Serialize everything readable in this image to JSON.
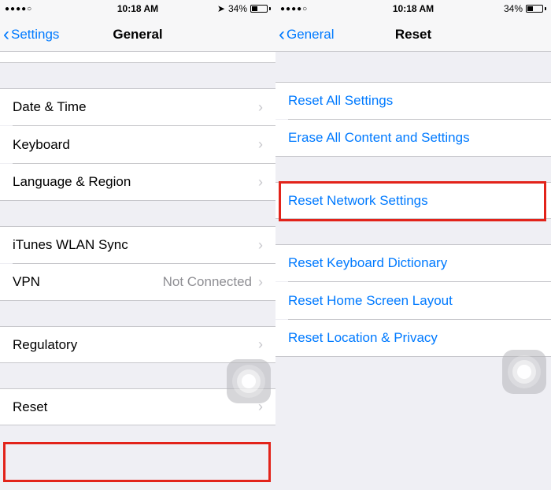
{
  "left": {
    "status": {
      "signal": "●●●●○",
      "time": "10:18 AM",
      "location_icon": "➤",
      "battery_pct": "34%"
    },
    "nav": {
      "back": "Settings",
      "title": "General"
    },
    "rows": {
      "date_time": "Date & Time",
      "keyboard": "Keyboard",
      "language_region": "Language & Region",
      "itunes_sync": "iTunes WLAN Sync",
      "vpn": "VPN",
      "vpn_value": "Not Connected",
      "regulatory": "Regulatory",
      "reset": "Reset"
    }
  },
  "right": {
    "status": {
      "signal": "●●●●○",
      "time": "10:18 AM",
      "battery_pct": "34%"
    },
    "nav": {
      "back": "General",
      "title": "Reset"
    },
    "rows": {
      "reset_all": "Reset All Settings",
      "erase_all": "Erase All Content and Settings",
      "reset_network": "Reset Network Settings",
      "reset_keyboard": "Reset Keyboard Dictionary",
      "reset_home": "Reset Home Screen Layout",
      "reset_location": "Reset Location & Privacy"
    }
  }
}
